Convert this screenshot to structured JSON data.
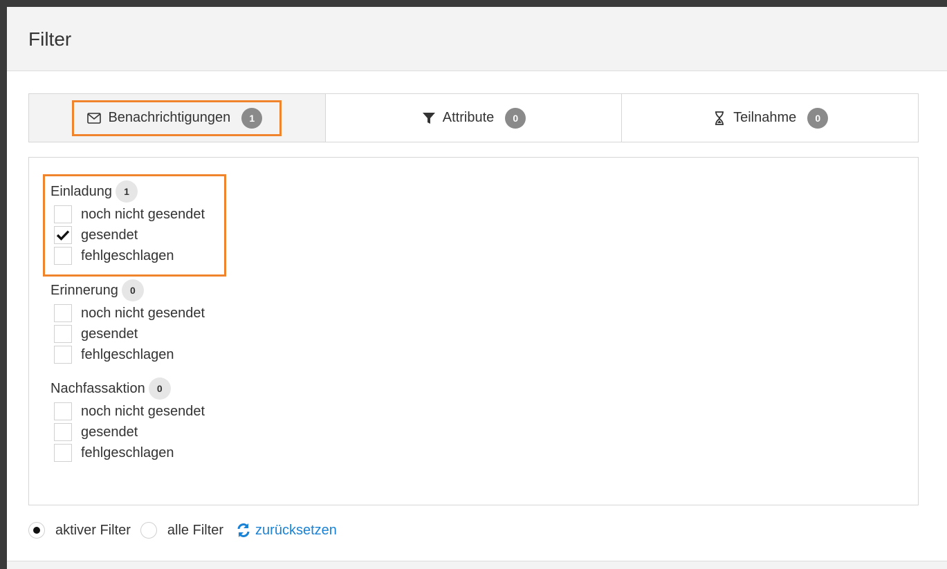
{
  "dialog": {
    "title": "Filter"
  },
  "tabs": [
    {
      "label": "Benachrichtigungen",
      "count": "1",
      "icon": "envelope-icon"
    },
    {
      "label": "Attribute",
      "count": "0",
      "icon": "filter-icon"
    },
    {
      "label": "Teilnahme",
      "count": "0",
      "icon": "hourglass-icon"
    }
  ],
  "groups": [
    {
      "title": "Einladung",
      "count": "1",
      "options": [
        {
          "label": "noch nicht gesendet",
          "checked": false
        },
        {
          "label": "gesendet",
          "checked": true
        },
        {
          "label": "fehlgeschlagen",
          "checked": false
        }
      ]
    },
    {
      "title": "Erinnerung",
      "count": "0",
      "options": [
        {
          "label": "noch nicht gesendet",
          "checked": false
        },
        {
          "label": "gesendet",
          "checked": false
        },
        {
          "label": "fehlgeschlagen",
          "checked": false
        }
      ]
    },
    {
      "title": "Nachfassaktion",
      "count": "0",
      "options": [
        {
          "label": "noch nicht gesendet",
          "checked": false
        },
        {
          "label": "gesendet",
          "checked": false
        },
        {
          "label": "fehlgeschlagen",
          "checked": false
        }
      ]
    }
  ],
  "footer": {
    "active_filter_label": "aktiver Filter",
    "all_filters_label": "alle Filter",
    "reset_label": "zurücksetzen",
    "selected": "aktiver Filter"
  },
  "colors": {
    "highlight": "#f0842c",
    "link": "#1a82d4",
    "badge": "#8a8a8a"
  }
}
